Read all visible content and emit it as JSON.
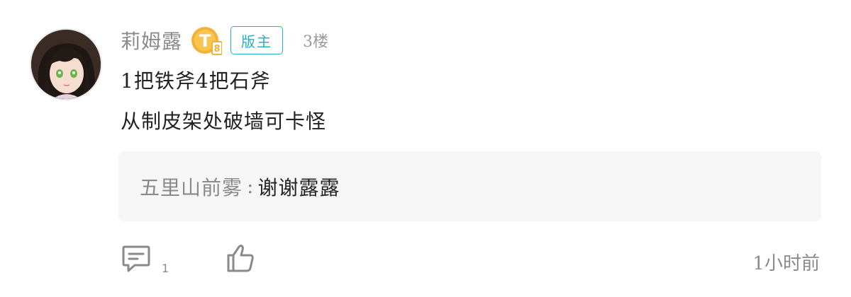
{
  "post": {
    "author": "莉姆露",
    "level_badge_letter": "T",
    "level_badge_number": "8",
    "role_badge": "版主",
    "floor": "3楼",
    "content_lines": [
      "1把铁斧4把石斧",
      "从制皮架处破墙可卡怪"
    ],
    "reply": {
      "author": "五里山前雾",
      "separator": ":",
      "text": "谢谢露露"
    },
    "comment_count": "1",
    "time": "1小时前"
  },
  "colors": {
    "role_badge": "#27b2c3",
    "level_badge": "#f2b233",
    "muted_text": "#8a8a8a",
    "reply_bg": "#f6f6f6"
  },
  "icons": {
    "comment": "comment-icon",
    "like": "thumbs-up-icon",
    "level": "level-badge-icon"
  }
}
